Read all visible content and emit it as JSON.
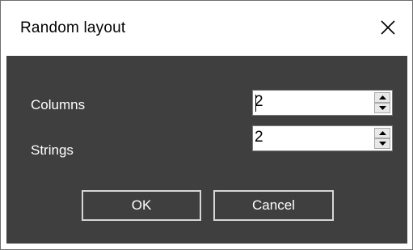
{
  "window": {
    "title": "Random layout"
  },
  "fields": [
    {
      "label": "Columns",
      "value": "2"
    },
    {
      "label": "Strings",
      "value": "2"
    }
  ],
  "buttons": {
    "ok": "OK",
    "cancel": "Cancel"
  },
  "icons": {
    "close": "close-icon",
    "up": "spin-up-icon",
    "down": "spin-down-icon"
  },
  "colors": {
    "client_background": "#3f3f3f",
    "text_light": "#ffffff",
    "button_border": "#d6d6d6"
  }
}
